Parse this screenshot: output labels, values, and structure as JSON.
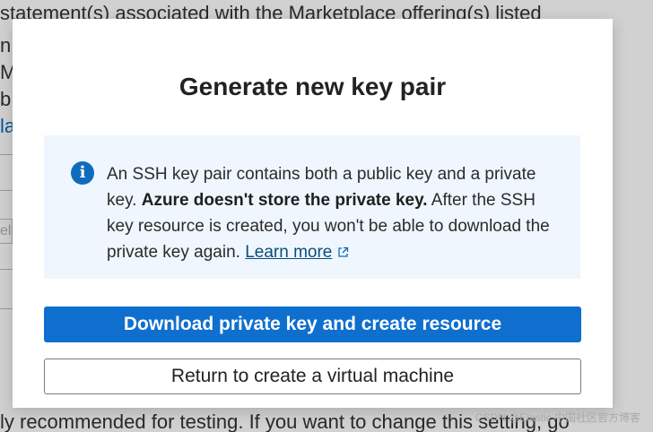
{
  "background": {
    "top_text": "statement(s) associated with the Marketplace offering(s) listed",
    "left_lines": [
      "n",
      "M",
      "b",
      "la"
    ],
    "field_placeholder": "ela",
    "bottom_text": "ly recommended for testing. If you want to change this setting, go"
  },
  "modal": {
    "title": "Generate new key pair",
    "info": {
      "icon": "info-icon",
      "text_part1": "An SSH key pair contains both a public key and a private key. ",
      "text_bold": "Azure doesn't store the private key.",
      "text_part2": " After the SSH key resource is created, you won't be able to download the private key again. ",
      "link_label": "Learn more",
      "link_icon": "external-link-icon"
    },
    "primary_button": "Download private key and create resource",
    "secondary_button": "Return to create a virtual machine"
  },
  "watermark": "CSDN @Elastic 中国社区官方博客",
  "colors": {
    "primary": "#0f6fcf",
    "info_bg": "#eff6fd",
    "info_icon": "#0f6cbd",
    "link": "#0b4e7a"
  }
}
